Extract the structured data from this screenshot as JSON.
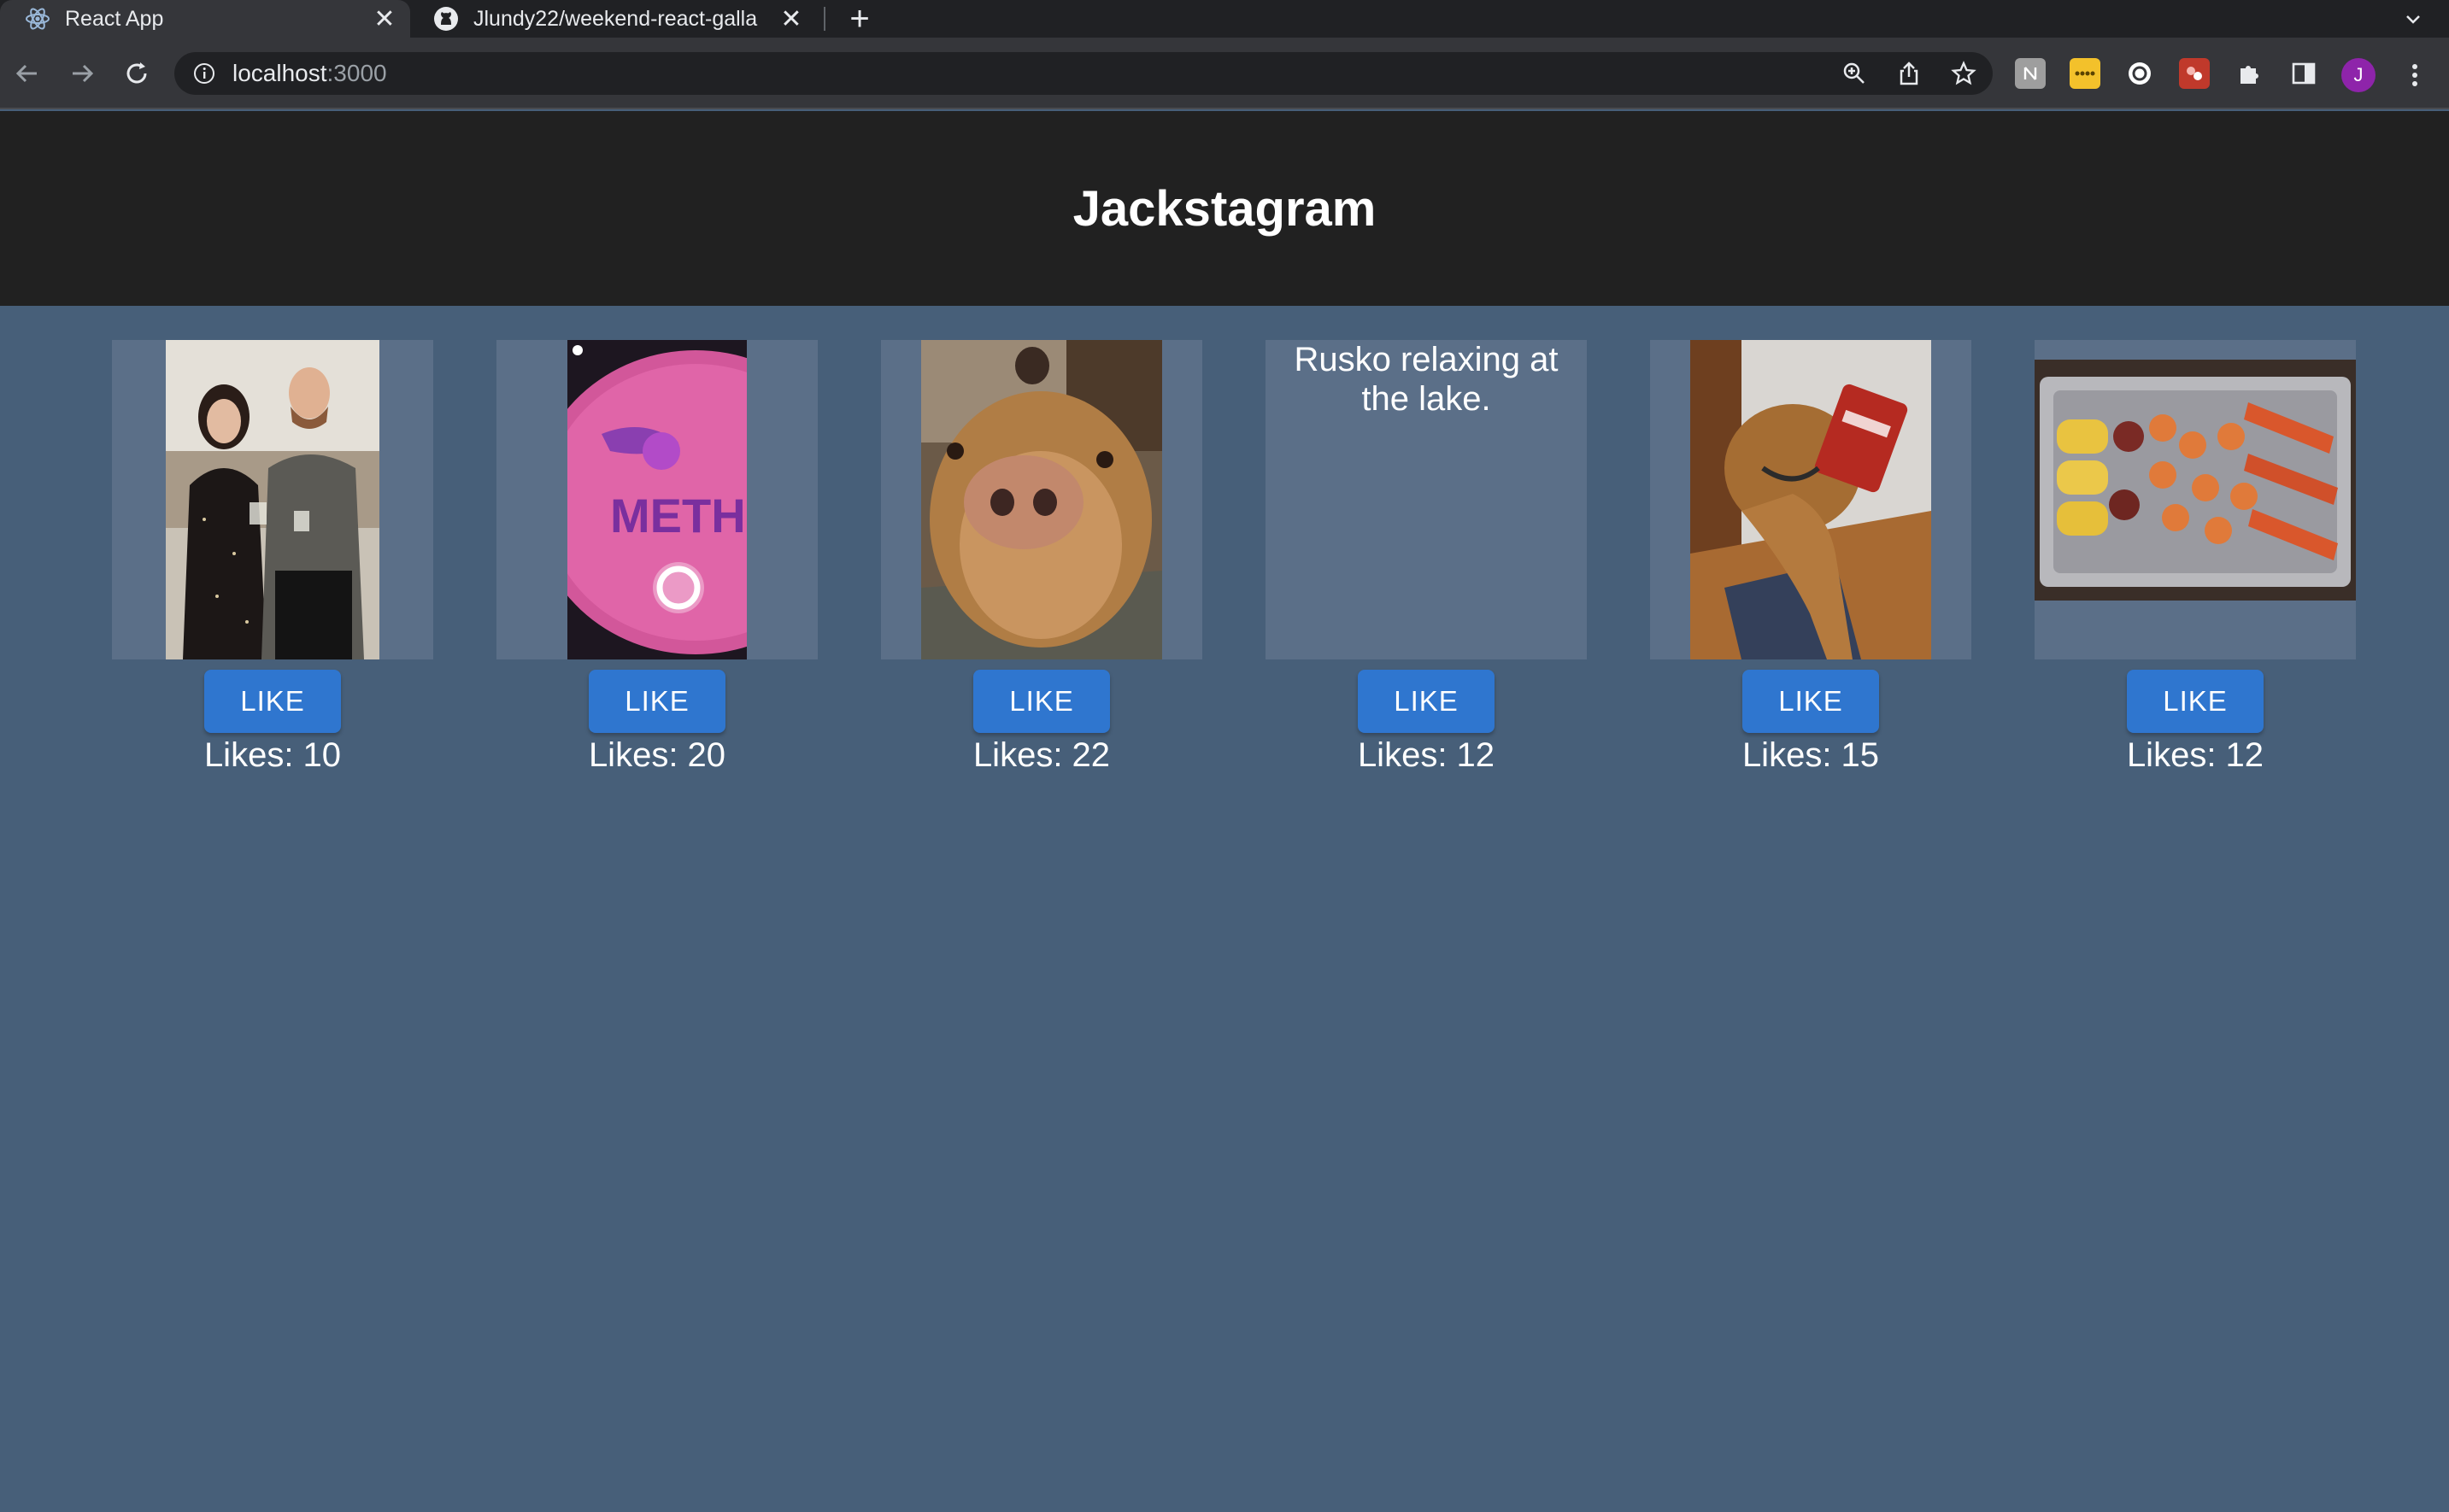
{
  "browser": {
    "tabs": [
      {
        "title": "React App",
        "favicon": "react-icon",
        "active": true
      },
      {
        "title": "Jlundy22/weekend-react-galla",
        "favicon": "github-icon",
        "active": false
      }
    ],
    "url_host": "localhost",
    "url_port": ":3000",
    "avatar_initial": "J",
    "extensions": [
      "notion-ext-icon",
      "password-ext-icon",
      "circle-ext-icon",
      "red-ext-icon"
    ]
  },
  "header": {
    "title": "Jackstagram"
  },
  "gallery": {
    "items": [
      {
        "image": "couple-photo",
        "like_label": "LIKE",
        "likes_text": "Likes: 10"
      },
      {
        "image": "disc-golf-photo",
        "like_label": "LIKE",
        "likes_text": "Likes: 20"
      },
      {
        "image": "dog-closeup-photo",
        "like_label": "LIKE",
        "likes_text": "Likes: 22"
      },
      {
        "description": "Rusko relaxing at the lake.",
        "like_label": "LIKE",
        "likes_text": "Likes: 12"
      },
      {
        "image": "dog-bag-photo",
        "like_label": "LIKE",
        "likes_text": "Likes: 15"
      },
      {
        "image": "seafood-boil-photo",
        "like_label": "LIKE",
        "likes_text": "Likes: 12"
      }
    ]
  },
  "colors": {
    "page_bg": "#475f79",
    "header_bg": "#212121",
    "card_bg": "#5b6f88",
    "button_bg": "#2f76cf"
  }
}
